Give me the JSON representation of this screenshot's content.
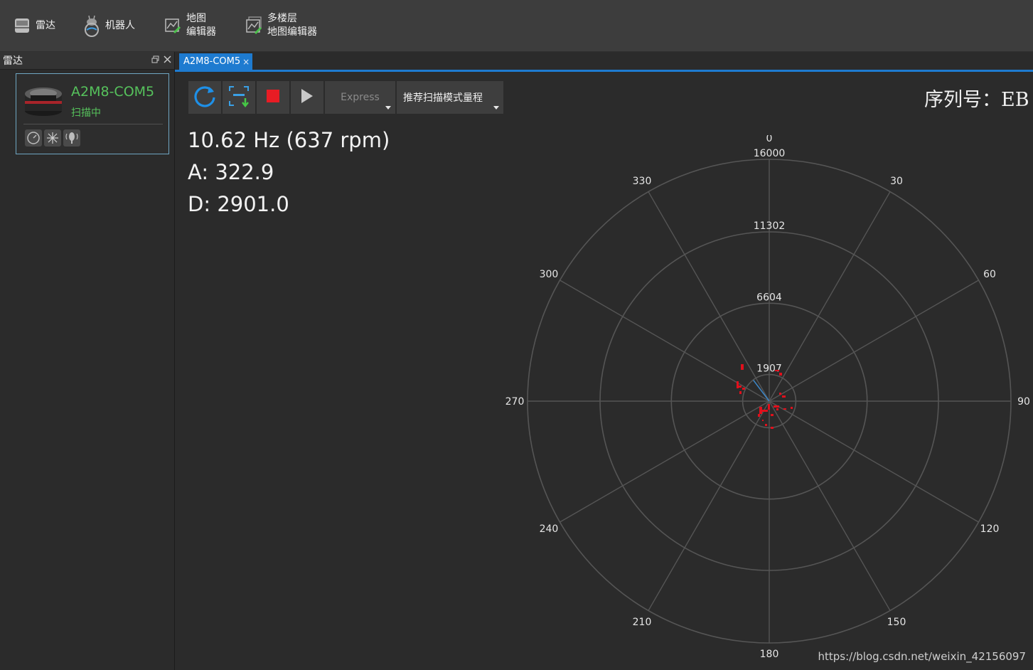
{
  "ribbon": {
    "items": [
      {
        "label": "雷达",
        "icon": "lidar-icon"
      },
      {
        "label": "机器人",
        "icon": "robot-icon"
      },
      {
        "label": "地图\n编辑器",
        "icon": "map-editor-icon"
      },
      {
        "label": "多楼层\n地图编辑器",
        "icon": "multi-floor-map-editor-icon"
      }
    ]
  },
  "sidebar": {
    "title": "雷达",
    "device": {
      "name": "A2M8-COM5",
      "status": "扫描中"
    },
    "tools": [
      "gauge-icon",
      "scan-burst-icon",
      "signal-icon"
    ]
  },
  "tab": {
    "label": "A2M8-COM5",
    "close": "×"
  },
  "toolbar": {
    "buttons": [
      "refresh-icon",
      "record-scan-icon",
      "stop-icon",
      "play-icon"
    ],
    "mode": "Express",
    "range": "推荐扫描模式量程"
  },
  "serial_label": "序列号：EB",
  "stats": {
    "frequency": "10.62 Hz (637 rpm)",
    "angle": "A: 322.9",
    "distance": "D: 2901.0"
  },
  "polar": {
    "ring_labels": [
      "1907",
      "6604",
      "11302",
      "16000"
    ],
    "angle_labels": [
      "0",
      "30",
      "60",
      "90",
      "120",
      "150",
      "180",
      "210",
      "240",
      "270",
      "300",
      "330"
    ],
    "max_range": 16000,
    "scan_color": "#e0101c",
    "grid_color": "#555555",
    "pointer_color": "#3d86c6",
    "pointer_angle": 322.9,
    "pointer_distance": 2901.0
  },
  "watermark": "https://blog.csdn.net/weixin_42156097"
}
